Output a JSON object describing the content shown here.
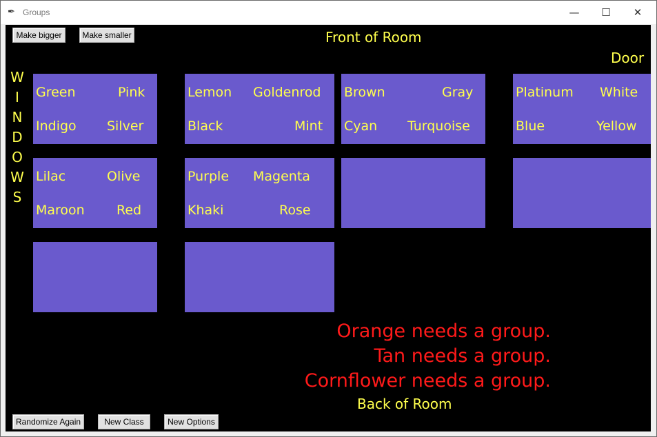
{
  "window": {
    "title": "Groups",
    "controls": {
      "minimize": "—",
      "maximize": "☐",
      "close": "✕"
    }
  },
  "buttons": {
    "make_bigger": "Make bigger",
    "make_smaller": "Make smaller",
    "randomize_again": "Randomize Again",
    "new_class": "New Class",
    "new_options": "New Options"
  },
  "room": {
    "front": "Front of Room",
    "back": "Back of Room",
    "door": "Door",
    "windows_letters": [
      "W",
      "I",
      "N",
      "D",
      "O",
      "W",
      "S"
    ]
  },
  "tables": [
    {
      "names": [
        "Green",
        "Pink",
        "Indigo",
        "Silver"
      ]
    },
    {
      "names": [
        "Lemon",
        "Goldenrod",
        "Black",
        "Mint"
      ]
    },
    {
      "names": [
        "Brown",
        "Gray",
        "Cyan",
        "Turquoise"
      ]
    },
    {
      "names": [
        "Platinum",
        "White",
        "Blue",
        "Yellow"
      ]
    },
    {
      "names": [
        "Lilac",
        "Olive",
        "Maroon",
        "Red"
      ]
    },
    {
      "names": [
        "Purple",
        "Magenta",
        "Khaki",
        "Rose"
      ]
    },
    {
      "names": []
    },
    {
      "names": []
    },
    {
      "names": []
    },
    {
      "names": []
    }
  ],
  "messages": [
    "Orange needs a group.",
    "Tan needs a group.",
    "Cornflower needs a group."
  ],
  "colors": {
    "canvas_bg": "#000000",
    "table_fill": "#6a5acd",
    "label_text": "#ffff4d",
    "warning_text": "#ff1a1a"
  }
}
